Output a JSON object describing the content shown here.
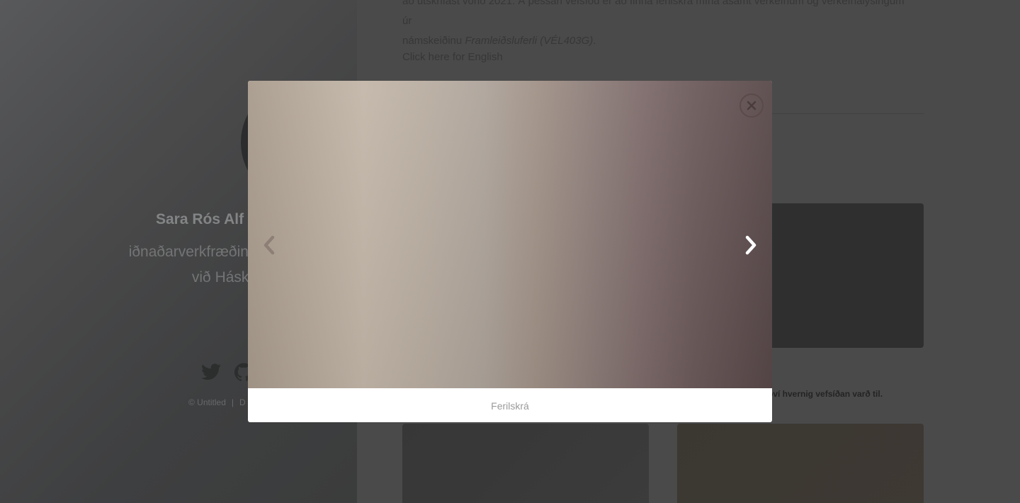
{
  "sidebar": {
    "name": "Sara Rós Alf",
    "tagline_line1": "iðnaðarverkfræðinemi a",
    "tagline_line2": "við Háskó",
    "social_icons": [
      "twitter-icon",
      "github-icon"
    ],
    "copyright": "© Untitled",
    "copyright_tail": "D"
  },
  "main": {
    "intro_line1": "að útskrifast vorið 2021. Á þessari vefsíðu er að finna ferilskrá mína ásamt verkefnum og verkefnalýsingum úr",
    "intro_line2_prefix": "námskeiðinu ",
    "intro_course": "Framleiðsluferli (VÉL403G)",
    "intro_line2_suffix": ".",
    "english_link": "Click here for English",
    "card_caption": "því hvernig vefsíðan varð til."
  },
  "lightbox": {
    "caption": "Ferilskrá",
    "close_icon": "close-icon",
    "prev_icon": "chevron-left-icon",
    "next_icon": "chevron-right-icon"
  }
}
